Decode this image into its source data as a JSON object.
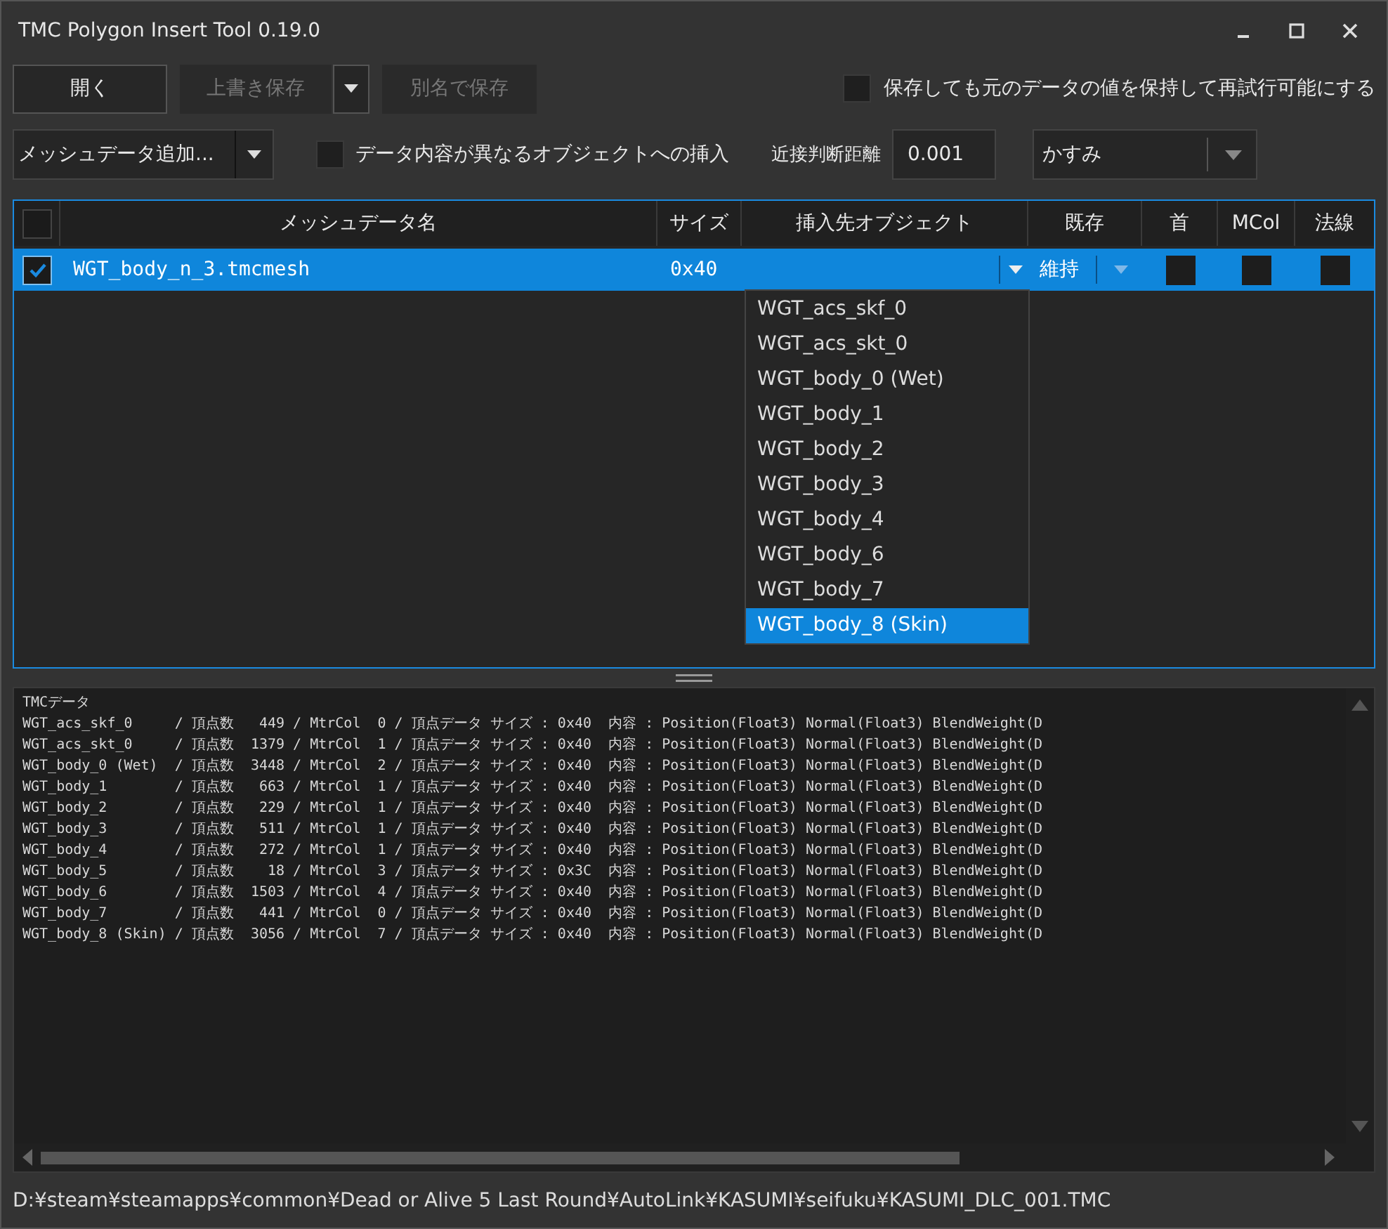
{
  "window": {
    "title": "TMC Polygon Insert Tool 0.19.0"
  },
  "toolbar": {
    "buttons": [
      {
        "kind": "button",
        "label": "開く",
        "disabled": false
      },
      {
        "kind": "split",
        "label": "上書き保存",
        "disabled": true
      },
      {
        "kind": "button",
        "label": "別名で保存",
        "disabled": true
      }
    ],
    "retain_checkbox": {
      "label": "保存しても元のデータの値を保持して再試行可能にする",
      "checked": false
    }
  },
  "options": {
    "mesh_add_combo": {
      "value": "メッシュデータ追加..."
    },
    "different_object_checkbox": {
      "label": "データ内容が異なるオブジェクトへの挿入",
      "checked": false
    },
    "distance": {
      "label": "近接判断距離",
      "value": "0.001"
    },
    "character_combo": {
      "value": "かすみ"
    }
  },
  "grid": {
    "header_checkbox": {
      "checked": false
    },
    "columns": [
      "メッシュデータ名",
      "サイズ",
      "挿入先オブジェクト",
      "既存",
      "首",
      "MCol",
      "法線"
    ],
    "rows": [
      {
        "checked": true,
        "selected": true,
        "name": "WGT_body_n_3.tmcmesh",
        "size": "0x40",
        "existing": "維持",
        "neck": false,
        "mcol": false,
        "normal": false
      }
    ],
    "dropdown": {
      "options": [
        {
          "label": "WGT_acs_skf_0",
          "selected": false
        },
        {
          "label": "WGT_acs_skt_0",
          "selected": false
        },
        {
          "label": "WGT_body_0 (Wet)",
          "selected": false
        },
        {
          "label": "WGT_body_1",
          "selected": false
        },
        {
          "label": "WGT_body_2",
          "selected": false
        },
        {
          "label": "WGT_body_3",
          "selected": false
        },
        {
          "label": "WGT_body_4",
          "selected": false
        },
        {
          "label": "WGT_body_6",
          "selected": false
        },
        {
          "label": "WGT_body_7",
          "selected": false
        },
        {
          "label": "WGT_body_8 (Skin)",
          "selected": true
        }
      ]
    }
  },
  "log": {
    "lines": [
      "TMCデータ",
      "WGT_acs_skf_0     / 頂点数   449 / MtrCol  0 / 頂点データ サイズ : 0x40  内容 : Position(Float3) Normal(Float3) BlendWeight(D",
      "WGT_acs_skt_0     / 頂点数  1379 / MtrCol  1 / 頂点データ サイズ : 0x40  内容 : Position(Float3) Normal(Float3) BlendWeight(D",
      "WGT_body_0 (Wet)  / 頂点数  3448 / MtrCol  2 / 頂点データ サイズ : 0x40  内容 : Position(Float3) Normal(Float3) BlendWeight(D",
      "WGT_body_1        / 頂点数   663 / MtrCol  1 / 頂点データ サイズ : 0x40  内容 : Position(Float3) Normal(Float3) BlendWeight(D",
      "WGT_body_2        / 頂点数   229 / MtrCol  1 / 頂点データ サイズ : 0x40  内容 : Position(Float3) Normal(Float3) BlendWeight(D",
      "WGT_body_3        / 頂点数   511 / MtrCol  1 / 頂点データ サイズ : 0x40  内容 : Position(Float3) Normal(Float3) BlendWeight(D",
      "WGT_body_4        / 頂点数   272 / MtrCol  1 / 頂点データ サイズ : 0x40  内容 : Position(Float3) Normal(Float3) BlendWeight(D",
      "WGT_body_5        / 頂点数    18 / MtrCol  3 / 頂点データ サイズ : 0x3C  内容 : Position(Float3) Normal(Float3) BlendWeight(D",
      "WGT_body_6        / 頂点数  1503 / MtrCol  4 / 頂点データ サイズ : 0x40  内容 : Position(Float3) Normal(Float3) BlendWeight(D",
      "WGT_body_7        / 頂点数   441 / MtrCol  0 / 頂点データ サイズ : 0x40  内容 : Position(Float3) Normal(Float3) BlendWeight(D",
      "WGT_body_8 (Skin) / 頂点数  3056 / MtrCol  7 / 頂点データ サイズ : 0x40  内容 : Position(Float3) Normal(Float3) BlendWeight(D"
    ]
  },
  "status_bar": {
    "path": "D:¥steam¥steamapps¥common¥Dead or Alive 5 Last Round¥AutoLink¥KASUMI¥seifuku¥KASUMI_DLC_001.TMC"
  }
}
